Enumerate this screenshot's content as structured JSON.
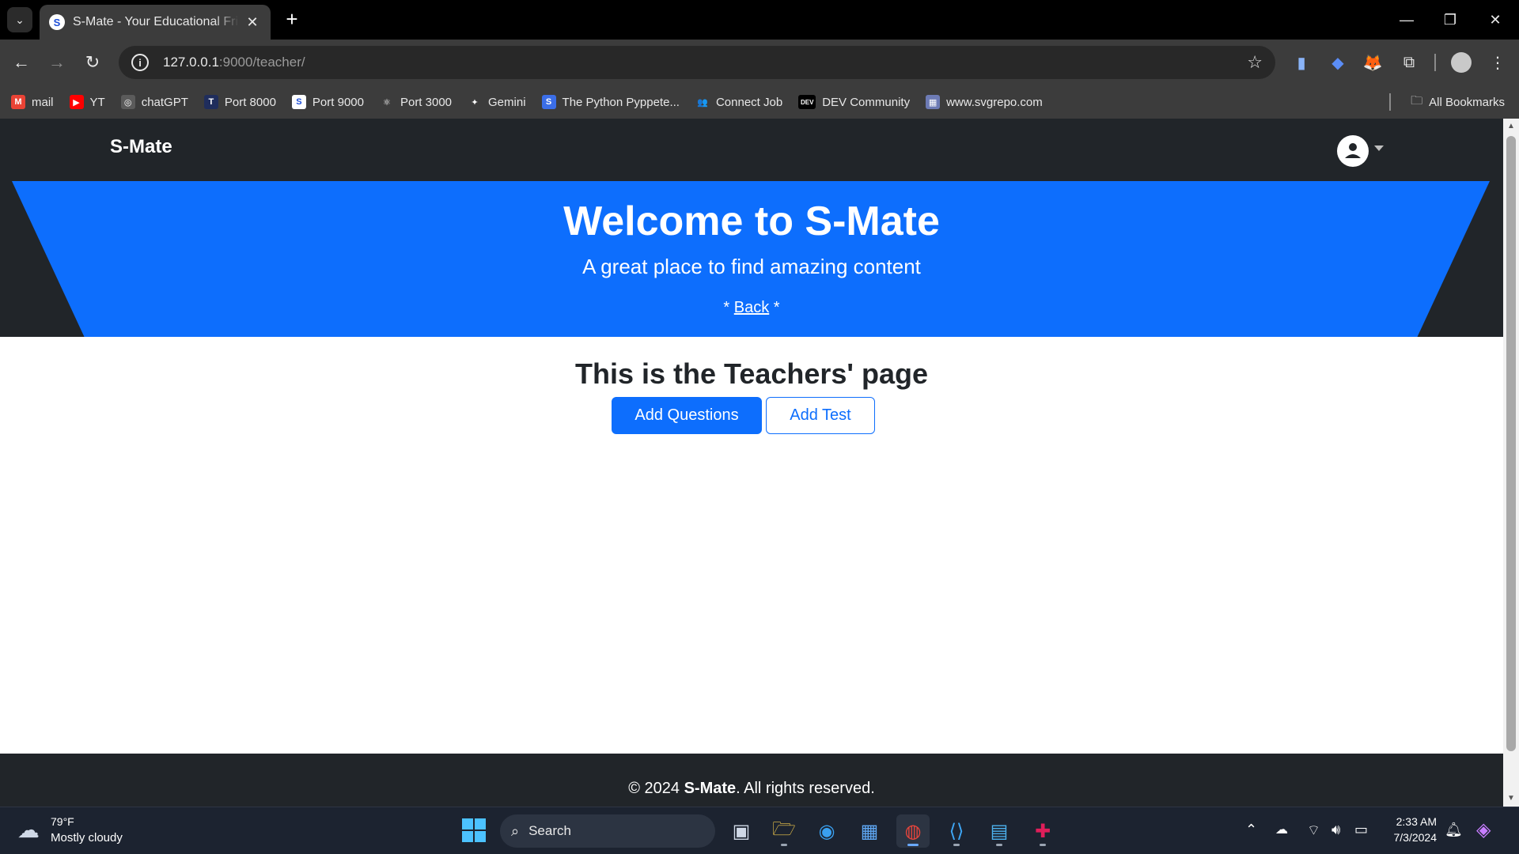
{
  "browser": {
    "tab_title": "S-Mate - Your Educational Friend",
    "tab_favicon_letter": "S",
    "url_host": "127.0.0.1",
    "url_rest": ":9000/teacher/",
    "bookmarks": [
      {
        "label": "mail",
        "icon": "gmail-icon",
        "color": "#ea4335",
        "glyph": "M"
      },
      {
        "label": "YT",
        "icon": "youtube-icon",
        "color": "#ff0000",
        "glyph": "▶"
      },
      {
        "label": "chatGPT",
        "icon": "chatgpt-icon",
        "color": "#5b5b5b",
        "glyph": "◎"
      },
      {
        "label": "Port 8000",
        "icon": "port-8000-icon",
        "color": "#1f2d5c",
        "glyph": "T"
      },
      {
        "label": "Port 9000",
        "icon": "port-9000-icon",
        "color": "#ffffff",
        "glyph": "S"
      },
      {
        "label": "Port 3000",
        "icon": "react-icon",
        "color": "#3c3c3c",
        "glyph": "⚛"
      },
      {
        "label": "Gemini",
        "icon": "gemini-icon",
        "color": "#3c3c3c",
        "glyph": "✦"
      },
      {
        "label": "The Python Pyppete...",
        "icon": "python-icon",
        "color": "#3b6ee8",
        "glyph": "S"
      },
      {
        "label": "Connect Job",
        "icon": "connect-job-icon",
        "color": "#3c3c3c",
        "glyph": "👥"
      },
      {
        "label": "DEV Community",
        "icon": "dev-icon",
        "color": "#000000",
        "glyph": "DEV"
      },
      {
        "label": "www.svgrepo.com",
        "icon": "svgrepo-icon",
        "color": "#6d7bb5",
        "glyph": "▦"
      }
    ],
    "all_bookmarks_label": "All Bookmarks"
  },
  "site": {
    "brand": "S-Mate",
    "hero": {
      "title": "Welcome to S-Mate",
      "subtitle": "A great place to find amazing content",
      "link_prefix": "* ",
      "link_label": "Back",
      "link_suffix": " *"
    },
    "page_heading": "This is the Teachers' page",
    "buttons": {
      "add_questions": "Add Questions",
      "add_test": "Add Test"
    },
    "footer": {
      "prefix": "© 2024 ",
      "brand": "S-Mate",
      "suffix": ". All rights reserved."
    },
    "colors": {
      "primary": "#0d6efd",
      "dark": "#212529"
    }
  },
  "taskbar": {
    "weather_temp": "79°F",
    "weather_desc": "Mostly cloudy",
    "search_label": "Search",
    "time": "2:33 AM",
    "date": "7/3/2024"
  }
}
